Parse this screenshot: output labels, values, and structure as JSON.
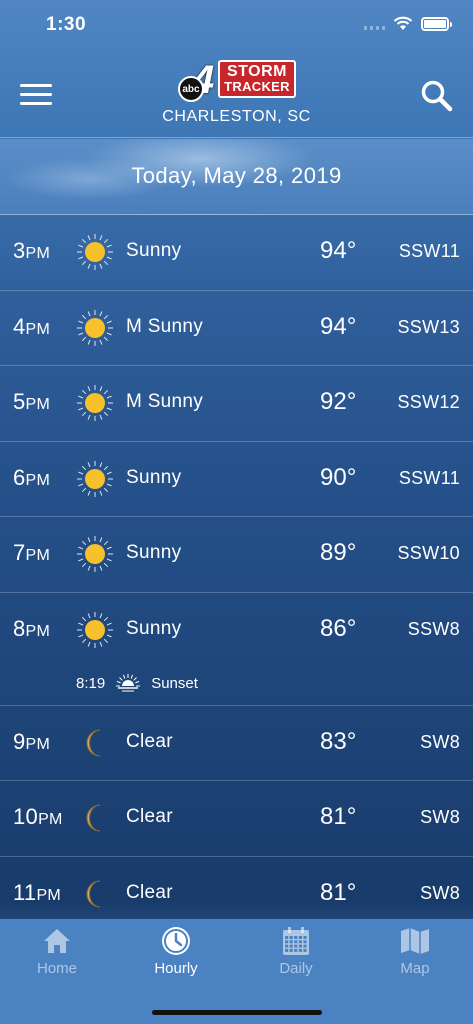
{
  "status_bar": {
    "time": "1:30"
  },
  "header": {
    "logo_abc": "abc",
    "logo_number": "4",
    "logo_line1": "STORM",
    "logo_line2": "TRACKER",
    "location": "CHARLESTON, SC"
  },
  "date_banner": {
    "text": "Today, May 28, 2019"
  },
  "hours": [
    {
      "hour": "3",
      "ampm": "PM",
      "icon": "sun-icon",
      "condition": "Sunny",
      "temp": "94°",
      "wind": "SSW11"
    },
    {
      "hour": "4",
      "ampm": "PM",
      "icon": "sun-icon",
      "condition": "M Sunny",
      "temp": "94°",
      "wind": "SSW13"
    },
    {
      "hour": "5",
      "ampm": "PM",
      "icon": "sun-icon",
      "condition": "M Sunny",
      "temp": "92°",
      "wind": "SSW12"
    },
    {
      "hour": "6",
      "ampm": "PM",
      "icon": "sun-icon",
      "condition": "Sunny",
      "temp": "90°",
      "wind": "SSW11"
    },
    {
      "hour": "7",
      "ampm": "PM",
      "icon": "sun-icon",
      "condition": "Sunny",
      "temp": "89°",
      "wind": "SSW10"
    },
    {
      "hour": "8",
      "ampm": "PM",
      "icon": "sun-icon",
      "condition": "Sunny",
      "temp": "86°",
      "wind": "SSW8"
    },
    {
      "hour": "9",
      "ampm": "PM",
      "icon": "moon-icon",
      "condition": "Clear",
      "temp": "83°",
      "wind": "SW8"
    },
    {
      "hour": "10",
      "ampm": "PM",
      "icon": "moon-icon",
      "condition": "Clear",
      "temp": "81°",
      "wind": "SW8"
    },
    {
      "hour": "11",
      "ampm": "PM",
      "icon": "moon-icon",
      "condition": "Clear",
      "temp": "81°",
      "wind": "SW8"
    }
  ],
  "sunset": {
    "time": "8:19",
    "label": "Sunset",
    "icon": "sunset-icon"
  },
  "tabs": [
    {
      "label": "Home",
      "icon": "home-icon",
      "active": false
    },
    {
      "label": "Hourly",
      "icon": "clock-icon",
      "active": true
    },
    {
      "label": "Daily",
      "icon": "calendar-icon",
      "active": false
    },
    {
      "label": "Map",
      "icon": "map-icon",
      "active": false
    }
  ],
  "colors": {
    "sun": "#f6c12a",
    "moon": "#c8a65a",
    "logo_red": "#c9262c",
    "tab_bar": "#4a82c2"
  }
}
